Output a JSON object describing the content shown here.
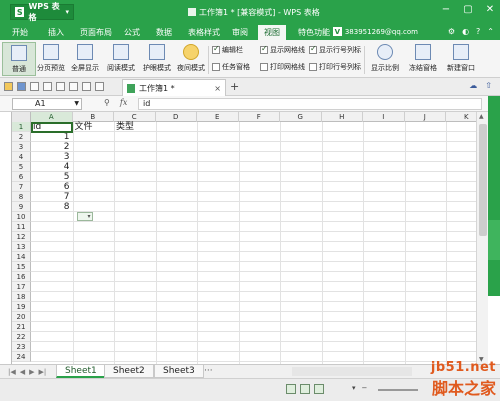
{
  "titlebar": {
    "app_name": "WPS 表格",
    "app_logo": "S",
    "window_title": "工作簿1 * [兼容模式] - WPS 表格"
  },
  "menus": [
    "开始",
    "插入",
    "页面布局",
    "公式",
    "数据",
    "表格样式",
    "审阅",
    "视图",
    "特色功能"
  ],
  "account": "383951269@qq.com",
  "ribbon": {
    "buttons": [
      "普通",
      "分页预览",
      "全屏显示",
      "阅读模式",
      "护眼模式",
      "夜间模式",
      "显示比例",
      "冻结窗格",
      "新建窗口"
    ],
    "checks": [
      {
        "label": "编辑栏",
        "checked": true
      },
      {
        "label": "显示网格线",
        "checked": true
      },
      {
        "label": "显示行号列标",
        "checked": true
      },
      {
        "label": "任务窗格",
        "checked": false
      },
      {
        "label": "打印网格线",
        "checked": false
      },
      {
        "label": "打印行号列标",
        "checked": false
      }
    ]
  },
  "doc_tab": {
    "label": "工作簿1 *",
    "close": "×",
    "add": "+"
  },
  "formula_bar": {
    "cell_ref": "A1",
    "formula": "id",
    "fx_label": "fx"
  },
  "grid": {
    "columns": [
      "A",
      "B",
      "C",
      "D",
      "E",
      "F",
      "G",
      "H",
      "I",
      "J",
      "K"
    ],
    "rows": [
      "1",
      "2",
      "3",
      "4",
      "5",
      "6",
      "7",
      "8",
      "9",
      "10",
      "11",
      "12",
      "13",
      "14",
      "15",
      "16",
      "17",
      "18",
      "19",
      "20",
      "21",
      "22",
      "23",
      "24"
    ],
    "header_row": [
      "id",
      "文件",
      "类型"
    ],
    "ids": [
      "1",
      "2",
      "3",
      "4",
      "5",
      "6",
      "7",
      "8"
    ]
  },
  "sheets": [
    "Sheet1",
    "Sheet2",
    "Sheet3"
  ],
  "sheet_more": "···",
  "watermark": {
    "site": "jb51.net",
    "name": "脚本之家"
  }
}
